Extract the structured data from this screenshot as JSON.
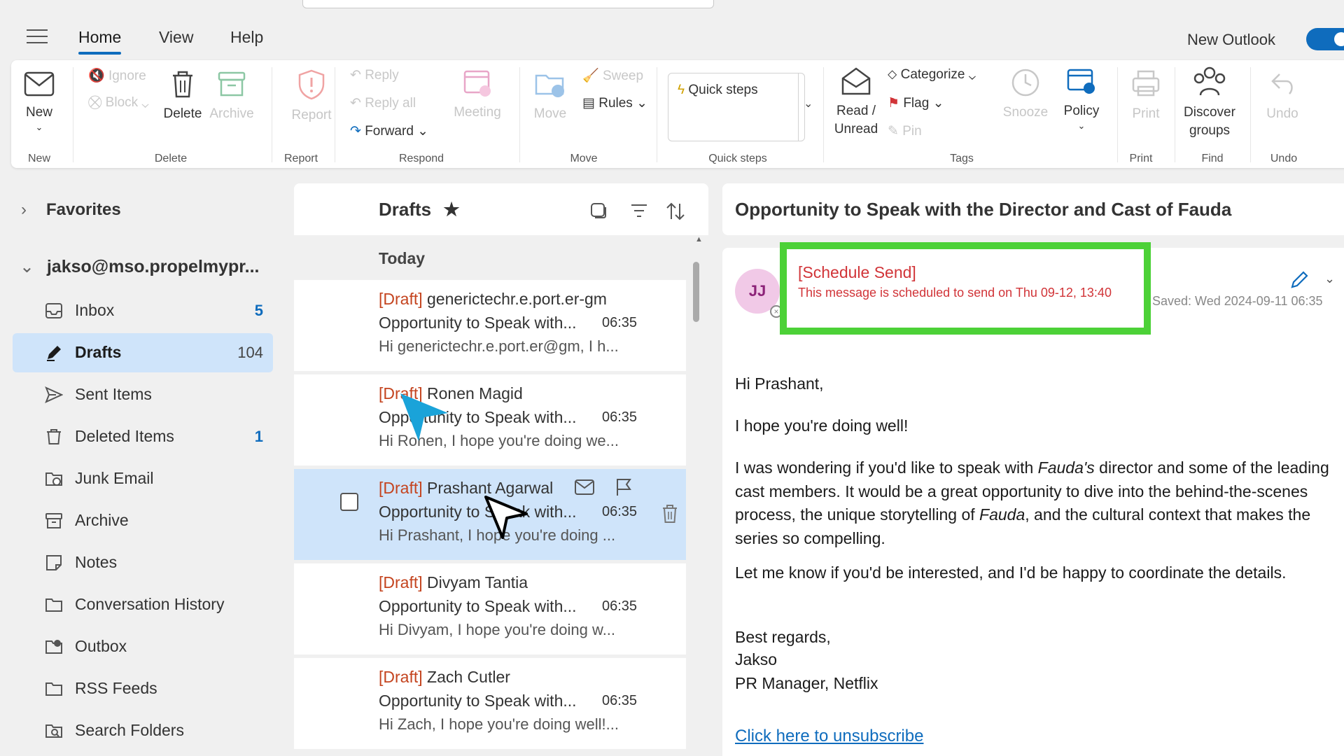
{
  "menu": {
    "tabs": [
      "Home",
      "View",
      "Help"
    ],
    "new_outlook_label": "New Outlook"
  },
  "ribbon": {
    "new": {
      "label": "New",
      "group": "New"
    },
    "delete_group": {
      "ignore": "Ignore",
      "block": "Block",
      "delete": "Delete",
      "archive": "Archive",
      "group": "Delete"
    },
    "report": {
      "label": "Report",
      "group": "Report"
    },
    "respond": {
      "reply": "Reply",
      "reply_all": "Reply all",
      "forward": "Forward",
      "meeting": "Meeting",
      "group": "Respond"
    },
    "move": {
      "move": "Move",
      "sweep": "Sweep",
      "rules": "Rules",
      "group": "Move"
    },
    "quick_steps": {
      "label": "Quick steps",
      "group": "Quick steps"
    },
    "tags": {
      "read_unread_1": "Read /",
      "read_unread_2": "Unread",
      "categorize": "Categorize",
      "flag": "Flag",
      "pin": "Pin",
      "snooze": "Snooze",
      "policy": "Policy",
      "group": "Tags"
    },
    "print": {
      "label": "Print",
      "group": "Print"
    },
    "find": {
      "label_1": "Discover",
      "label_2": "groups",
      "group": "Find"
    },
    "undo": {
      "label": "Undo",
      "group": "Undo"
    }
  },
  "sidebar": {
    "favorites": "Favorites",
    "account": "jakso@mso.propelmypr...",
    "folders": [
      {
        "label": "Inbox",
        "count": "5",
        "icon": "inbox-icon"
      },
      {
        "label": "Drafts",
        "count": "104",
        "icon": "pencil-icon"
      },
      {
        "label": "Sent Items",
        "count": "",
        "icon": "send-icon"
      },
      {
        "label": "Deleted Items",
        "count": "1",
        "icon": "trash-icon"
      },
      {
        "label": "Junk Email",
        "count": "",
        "icon": "junk-icon"
      },
      {
        "label": "Archive",
        "count": "",
        "icon": "archive-icon"
      },
      {
        "label": "Notes",
        "count": "",
        "icon": "note-icon"
      },
      {
        "label": "Conversation History",
        "count": "",
        "icon": "folder-icon"
      },
      {
        "label": "Outbox",
        "count": "",
        "icon": "outbox-icon"
      },
      {
        "label": "RSS Feeds",
        "count": "",
        "icon": "folder-icon"
      },
      {
        "label": "Search Folders",
        "count": "",
        "icon": "search-folder-icon"
      }
    ]
  },
  "list": {
    "title": "Drafts",
    "group_header": "Today",
    "draft_tag": "[Draft]",
    "messages": [
      {
        "to": "generictechr.e.port.er-gm",
        "subject": "Opportunity to Speak with...",
        "time": "06:35",
        "preview": "Hi generictechr.e.port.er@gm, I h..."
      },
      {
        "to": "Ronen Magid",
        "subject": "Opportunity to Speak with...",
        "time": "06:35",
        "preview": "Hi Ronen, I hope you're doing we..."
      },
      {
        "to": "Prashant Agarwal",
        "subject": "Opportunity to Speak with...",
        "time": "06:35",
        "preview": "Hi Prashant, I hope you're doing ..."
      },
      {
        "to": "Divyam Tantia",
        "subject": "Opportunity to Speak with...",
        "time": "06:35",
        "preview": "Hi Divyam, I hope you're doing w..."
      },
      {
        "to": "Zach Cutler",
        "subject": "Opportunity to Speak with...",
        "time": "06:35",
        "preview": "Hi Zach, I hope you're doing well!..."
      }
    ]
  },
  "reading": {
    "subject": "Opportunity to Speak with the Director and Cast of Fauda",
    "avatar_initials": "JJ",
    "schedule_label": "[Schedule Send]",
    "schedule_text": "This message is scheduled to send on Thu 09-12, 13:40",
    "saved": "Saved: Wed 2024-09-11 06:35",
    "greeting": "Hi Prashant,",
    "p1": "I hope you're doing well!",
    "p2_a": "I was wondering if you'd like to speak with ",
    "p2_b": "Fauda's",
    "p2_c": " director and some of the leading cast members. It would be a great opportunity to dive into the behind-the-scenes process, the unique storytelling of ",
    "p2_d": "Fauda",
    "p2_e": ", and the cultural context that makes the series so compelling.",
    "p3": "Let me know if you'd be interested, and I'd be happy to coordinate the details.",
    "sign_1": "Best regards,",
    "sign_2": "Jakso",
    "sign_3": "PR Manager, Netflix",
    "unsubscribe": "Click here to unsubscribe"
  },
  "colors": {
    "accent": "#0f6cbd",
    "draft_tag": "#c4441f",
    "schedule": "#d13438",
    "highlight_box": "#4cd137",
    "selected_bg": "#cfe4fa"
  }
}
